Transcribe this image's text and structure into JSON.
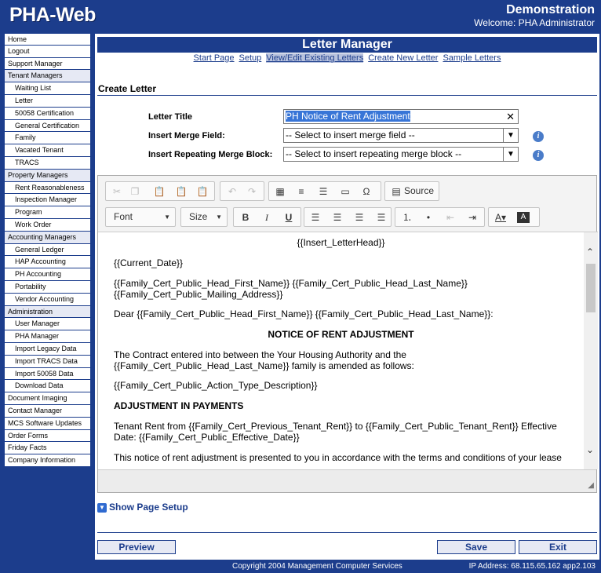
{
  "header": {
    "logo": "PHA-Web",
    "site_title": "Demonstration",
    "welcome": "Welcome: PHA Administrator"
  },
  "sidebar": [
    {
      "label": "Home",
      "type": "top"
    },
    {
      "label": "Logout",
      "type": "top"
    },
    {
      "label": "Support Manager",
      "type": "top"
    },
    {
      "label": "Tenant Managers",
      "type": "hdr"
    },
    {
      "label": "Waiting List",
      "type": "sub"
    },
    {
      "label": "Letter",
      "type": "sub"
    },
    {
      "label": "50058 Certification",
      "type": "sub"
    },
    {
      "label": "General Certification",
      "type": "sub"
    },
    {
      "label": "Family",
      "type": "sub"
    },
    {
      "label": "Vacated Tenant",
      "type": "sub"
    },
    {
      "label": "TRACS",
      "type": "sub"
    },
    {
      "label": "Property Managers",
      "type": "hdr"
    },
    {
      "label": "Rent Reasonableness",
      "type": "sub"
    },
    {
      "label": "Inspection Manager",
      "type": "sub"
    },
    {
      "label": "Program",
      "type": "sub"
    },
    {
      "label": "Work Order",
      "type": "sub"
    },
    {
      "label": "Accounting Managers",
      "type": "hdr"
    },
    {
      "label": "General Ledger",
      "type": "sub"
    },
    {
      "label": "HAP Accounting",
      "type": "sub"
    },
    {
      "label": "PH Accounting",
      "type": "sub"
    },
    {
      "label": "Portability",
      "type": "sub"
    },
    {
      "label": "Vendor Accounting",
      "type": "sub"
    },
    {
      "label": "Administration",
      "type": "hdr"
    },
    {
      "label": "User Manager",
      "type": "sub"
    },
    {
      "label": "PHA Manager",
      "type": "sub"
    },
    {
      "label": "Import Legacy Data",
      "type": "sub"
    },
    {
      "label": "Import TRACS Data",
      "type": "sub"
    },
    {
      "label": "Import 50058 Data",
      "type": "sub"
    },
    {
      "label": "Download Data",
      "type": "sub"
    },
    {
      "label": "Document Imaging",
      "type": "top"
    },
    {
      "label": "Contact Manager",
      "type": "top"
    },
    {
      "label": "MCS Software Updates",
      "type": "top"
    },
    {
      "label": "Order Forms",
      "type": "top"
    },
    {
      "label": "Friday Facts",
      "type": "top"
    },
    {
      "label": "Company Information",
      "type": "top"
    }
  ],
  "page": {
    "title": "Letter Manager",
    "section": "Create Letter"
  },
  "subnav": [
    {
      "label": "Start Page",
      "active": false
    },
    {
      "label": "Setup",
      "active": false
    },
    {
      "label": "View/Edit Existing Letters",
      "active": true
    },
    {
      "label": "Create New Letter",
      "active": false
    },
    {
      "label": "Sample Letters",
      "active": false
    }
  ],
  "form": {
    "letter_title_label": "Letter Title",
    "letter_title_value": "PH Notice of Rent Adjustment",
    "merge_field_label": "Insert Merge Field:",
    "merge_field_value": "-- Select to insert merge field --",
    "merge_block_label": "Insert Repeating Merge Block:",
    "merge_block_value": "-- Select to insert repeating merge block --"
  },
  "toolbar": {
    "source_label": "Source",
    "font_label": "Font",
    "size_label": "Size"
  },
  "document": {
    "lines": [
      {
        "text": "{{Insert_LetterHead}}",
        "style": "center"
      },
      {
        "text": "{{Current_Date}}",
        "style": "normal"
      },
      {
        "text": "{{Family_Cert_Public_Head_First_Name}} {{Family_Cert_Public_Head_Last_Name}}",
        "style": "normal"
      },
      {
        "text": "{{Family_Cert_Public_Mailing_Address}}",
        "style": "normal"
      },
      {
        "text": "Dear {{Family_Cert_Public_Head_First_Name}} {{Family_Cert_Public_Head_Last_Name}}:",
        "style": "normal"
      },
      {
        "text": "NOTICE OF RENT ADJUSTMENT",
        "style": "center-bold"
      },
      {
        "text": "The Contract entered into between the Your Housing Authority and the",
        "style": "normal"
      },
      {
        "text": "{{Family_Cert_Public_Head_Last_Name}} family is amended as follows:",
        "style": "normal"
      },
      {
        "text": "{{Family_Cert_Public_Action_Type_Description}}",
        "style": "normal"
      },
      {
        "text": "ADJUSTMENT IN PAYMENTS",
        "style": "bold"
      },
      {
        "text": "Tenant Rent from {{Family_Cert_Previous_Tenant_Rent}} to {{Family_Cert_Public_Tenant_Rent}} Effective",
        "style": "normal"
      },
      {
        "text": "Date:  {{Family_Cert_Public_Effective_Date}}",
        "style": "normal"
      },
      {
        "text": "This notice of rent adjustment is presented to you in accordance with the terms and conditions of your lease",
        "style": "normal"
      }
    ]
  },
  "show_page_setup": "Show Page Setup",
  "buttons": {
    "preview": "Preview",
    "save": "Save",
    "exit": "Exit"
  },
  "footer": {
    "copyright": "Copyright 2004 Management Computer Services",
    "ip": "IP Address: 68.115.65.162 app2.103"
  }
}
